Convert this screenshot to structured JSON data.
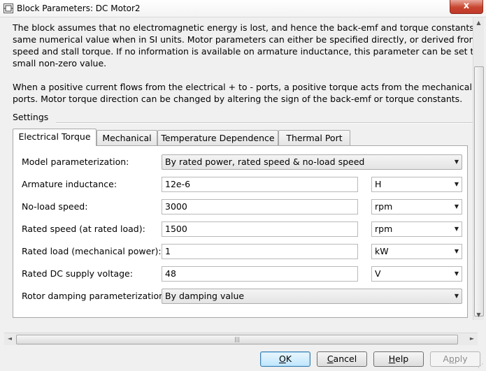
{
  "window": {
    "title": "Block Parameters: DC Motor2",
    "close_glyph": "x"
  },
  "description": {
    "para1": [
      "The block assumes that no electromagnetic energy is lost, and hence the back-emf and torque constants have the",
      "same numerical value when in SI units. Motor parameters can either be specified directly, or derived from no-load",
      "speed and stall torque. If no information is available on armature inductance, this parameter can be set to some",
      "small non-zero value."
    ],
    "para2": [
      "When a positive current flows from the electrical + to - ports, a positive torque acts from the mechanical C to R",
      "ports. Motor torque direction can be changed by altering the sign of the back-emf or torque constants."
    ]
  },
  "settings_label": "Settings",
  "tabs": [
    {
      "label": "Electrical Torque",
      "active": true
    },
    {
      "label": "Mechanical",
      "active": false
    },
    {
      "label": "Temperature Dependence",
      "active": false
    },
    {
      "label": "Thermal Port",
      "active": false
    }
  ],
  "params": {
    "model_parameterization": {
      "label": "Model parameterization:",
      "value": "By rated power, rated speed & no-load speed"
    },
    "armature_inductance": {
      "label": "Armature inductance:",
      "value": "12e-6",
      "unit": "H"
    },
    "no_load_speed": {
      "label": "No-load speed:",
      "value": "3000",
      "unit": "rpm"
    },
    "rated_speed": {
      "label": "Rated speed (at rated load):",
      "value": "1500",
      "unit": "rpm"
    },
    "rated_load": {
      "label": "Rated load (mechanical power):",
      "value": "1",
      "unit": "kW"
    },
    "rated_dc_voltage": {
      "label": "Rated DC supply voltage:",
      "value": "48",
      "unit": "V"
    },
    "rotor_damping": {
      "label": "Rotor damping parameterization:",
      "value": "By damping value"
    }
  },
  "buttons": {
    "ok": {
      "mnemonic": "O",
      "rest": "K"
    },
    "cancel": {
      "mnemonic": "C",
      "rest": "ancel"
    },
    "help": {
      "mnemonic": "H",
      "rest": "elp"
    },
    "apply": {
      "pre": "A",
      "mnemonic": "p",
      "rest": "ply"
    }
  },
  "icons": {
    "dropdown": "chevron-down-icon",
    "scroll": "scroll-arrow-icon",
    "grip": "resize-grip-icon"
  }
}
